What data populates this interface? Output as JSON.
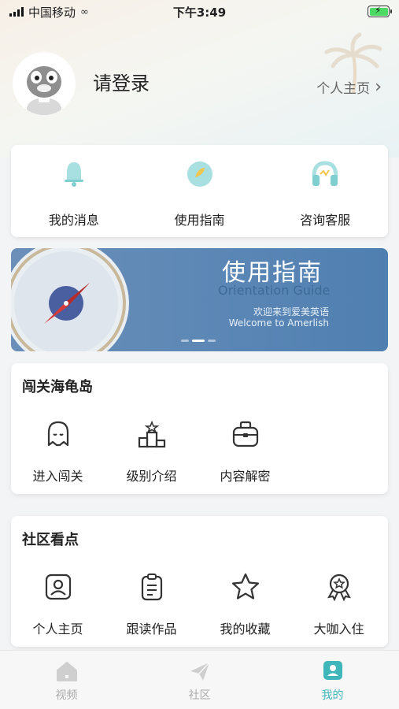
{
  "status_bar": {
    "carrier": "中国移动",
    "time": "下午3:49"
  },
  "profile": {
    "login_label": "请登录",
    "home_link": "个人主页",
    "chevron": "›"
  },
  "quick_actions": [
    {
      "label": "我的消息",
      "icon": "bell-icon"
    },
    {
      "label": "使用指南",
      "icon": "guide-icon"
    },
    {
      "label": "咨询客服",
      "icon": "headset-icon"
    }
  ],
  "banner": {
    "title": "使用指南",
    "subtitle": "Orientation Guide",
    "line_cn": "欢迎来到爱美英语",
    "line_en": "Welcome to Amerlish",
    "active_slide": 2,
    "slide_count": 3
  },
  "section_island": {
    "title": "闯关海龟岛",
    "items": [
      {
        "label": "进入闯关",
        "icon": "ghost-icon"
      },
      {
        "label": "级别介绍",
        "icon": "podium-icon"
      },
      {
        "label": "内容解密",
        "icon": "bag-icon"
      }
    ]
  },
  "section_community": {
    "title": "社区看点",
    "items": [
      {
        "label": "个人主页",
        "icon": "user-card-icon"
      },
      {
        "label": "跟读作品",
        "icon": "clipboard-icon"
      },
      {
        "label": "我的收藏",
        "icon": "star-icon"
      },
      {
        "label": "大咖入住",
        "icon": "badge-icon"
      }
    ]
  },
  "tabbar": [
    {
      "label": "视频",
      "icon": "home-icon",
      "active": false
    },
    {
      "label": "社区",
      "icon": "paper-plane-icon",
      "active": false
    },
    {
      "label": "我的",
      "icon": "profile-icon",
      "active": true
    }
  ],
  "colors": {
    "accent": "#3fb6b9",
    "banner_blue": "#5a86b5",
    "text": "#222222",
    "muted": "#666666"
  }
}
